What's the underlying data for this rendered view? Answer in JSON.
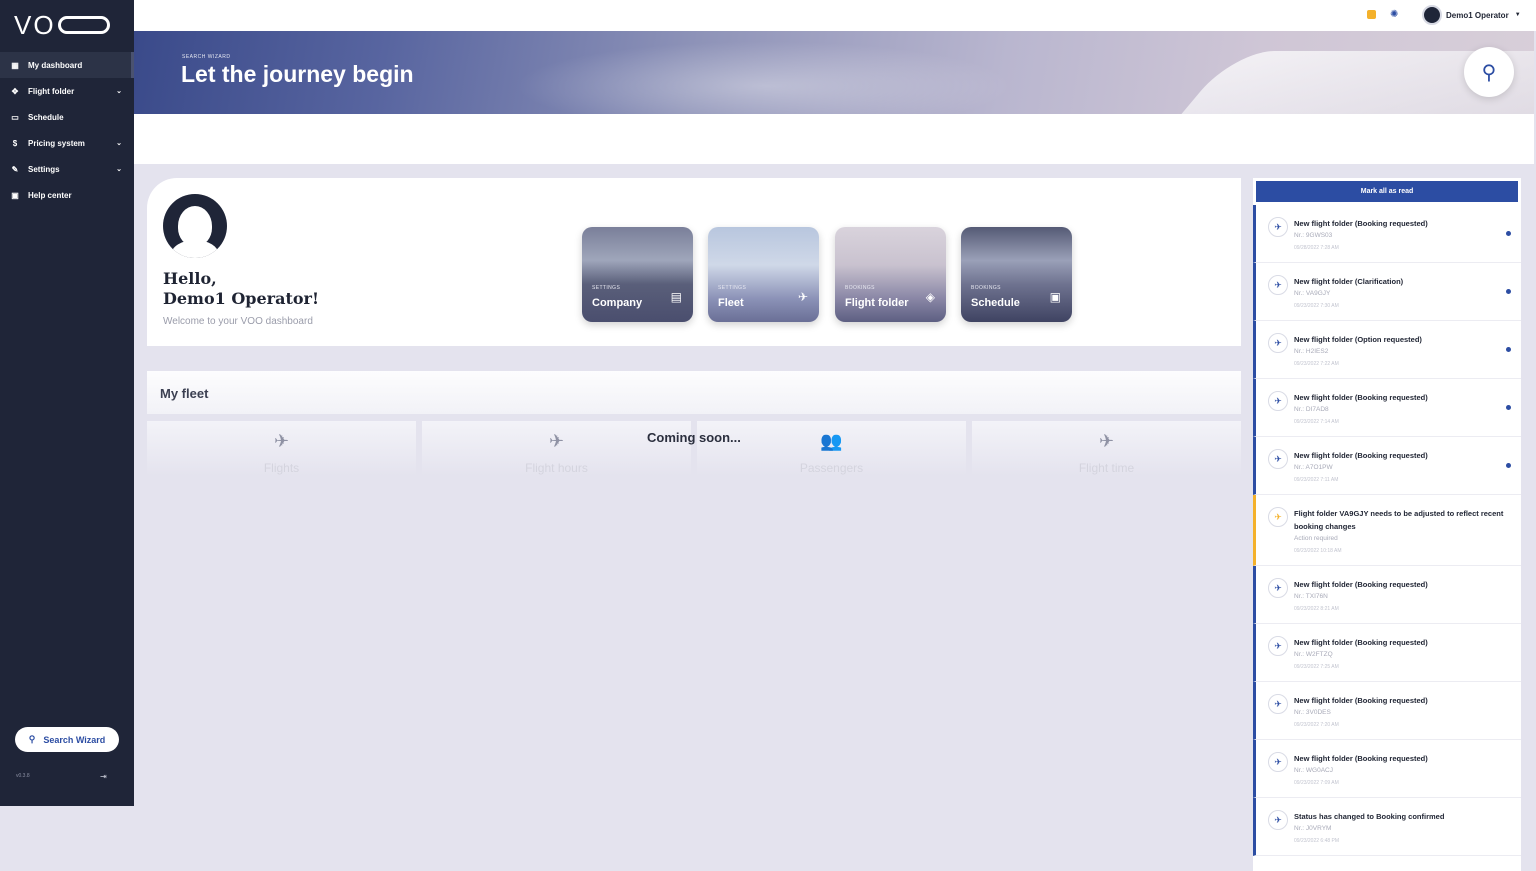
{
  "brand": {
    "logo_text": "VO"
  },
  "sidebar": {
    "items": [
      {
        "label": "My dashboard",
        "icon": "dashboard-icon",
        "has_children": false
      },
      {
        "label": "Flight folder",
        "icon": "flight-folder-icon",
        "has_children": true
      },
      {
        "label": "Schedule",
        "icon": "calendar-icon",
        "has_children": false
      },
      {
        "label": "Pricing system",
        "icon": "dollar-icon",
        "has_children": true
      },
      {
        "label": "Settings",
        "icon": "wrench-icon",
        "has_children": true
      },
      {
        "label": "Help center",
        "icon": "help-icon",
        "has_children": false
      }
    ],
    "search_wizard_label": "Search Wizard",
    "version": "v0.3.8"
  },
  "topbar": {
    "user_name": "Demo1 Operator"
  },
  "hero": {
    "subtitle": "SEARCH WIZARD",
    "title": "Let the journey begin"
  },
  "welcome": {
    "greeting_line1": "Hello,",
    "greeting_line2": "Demo1 Operator!",
    "subtitle": "Welcome to your VOO dashboard"
  },
  "tiles": [
    {
      "category": "SETTINGS",
      "name": "Company",
      "icon": "building-icon"
    },
    {
      "category": "SETTINGS",
      "name": "Fleet",
      "icon": "plane-icon"
    },
    {
      "category": "BOOKINGS",
      "name": "Flight folder",
      "icon": "layers-icon"
    },
    {
      "category": "BOOKINGS",
      "name": "Schedule",
      "icon": "calendar-icon"
    }
  ],
  "fleet": {
    "title": "My fleet",
    "coming_soon": "Coming soon...",
    "cards": [
      {
        "label": "Flights",
        "icon": "plane-icon"
      },
      {
        "label": "Flight hours",
        "icon": "plane-clock-icon"
      },
      {
        "label": "Passengers",
        "icon": "people-icon"
      },
      {
        "label": "Flight time",
        "icon": "plane-takeoff-icon"
      }
    ]
  },
  "notifications": {
    "mark_all_label": "Mark all as read",
    "items": [
      {
        "title": "New flight folder (Booking requested)",
        "nr": "Nr.: 9GWS03",
        "date": "09/28/2022 7:28 AM",
        "unread": true,
        "warn": false
      },
      {
        "title": "New flight folder (Clarification)",
        "nr": "Nr.: VA9GJY",
        "date": "09/23/2022 7:30 AM",
        "unread": true,
        "warn": false
      },
      {
        "title": "New flight folder (Option requested)",
        "nr": "Nr.: H2IES2",
        "date": "09/23/2022 7:22 AM",
        "unread": true,
        "warn": false
      },
      {
        "title": "New flight folder (Booking requested)",
        "nr": "Nr.: DI7AD8",
        "date": "09/23/2022 7:14 AM",
        "unread": true,
        "warn": false
      },
      {
        "title": "New flight folder (Booking requested)",
        "nr": "Nr.: A7O1PW",
        "date": "09/23/2022 7:11 AM",
        "unread": true,
        "warn": false
      },
      {
        "title": "Flight folder VA9GJY needs to be adjusted to reflect recent booking changes",
        "nr": "Action required",
        "date": "09/23/2022 10:18 AM",
        "unread": false,
        "warn": true
      },
      {
        "title": "New flight folder (Booking requested)",
        "nr": "Nr.: TXI76N",
        "date": "09/23/2022 8:21 AM",
        "unread": false,
        "warn": false
      },
      {
        "title": "New flight folder (Booking requested)",
        "nr": "Nr.: W2FTZQ",
        "date": "09/23/2022 7:25 AM",
        "unread": false,
        "warn": false
      },
      {
        "title": "New flight folder (Booking requested)",
        "nr": "Nr.: 3V0DES",
        "date": "09/23/2022 7:20 AM",
        "unread": false,
        "warn": false
      },
      {
        "title": "New flight folder (Booking requested)",
        "nr": "Nr.: WG0ACJ",
        "date": "09/23/2022 7:09 AM",
        "unread": false,
        "warn": false
      },
      {
        "title": "Status has changed to Booking confirmed",
        "nr": "Nr.: J0VRYM",
        "date": "09/23/2022 6:48 PM",
        "unread": false,
        "warn": false
      }
    ]
  },
  "colors": {
    "sidebar": "#1f2538",
    "accent": "#2c4da3",
    "warning": "#f4b12b",
    "background": "#e4e3ee"
  }
}
